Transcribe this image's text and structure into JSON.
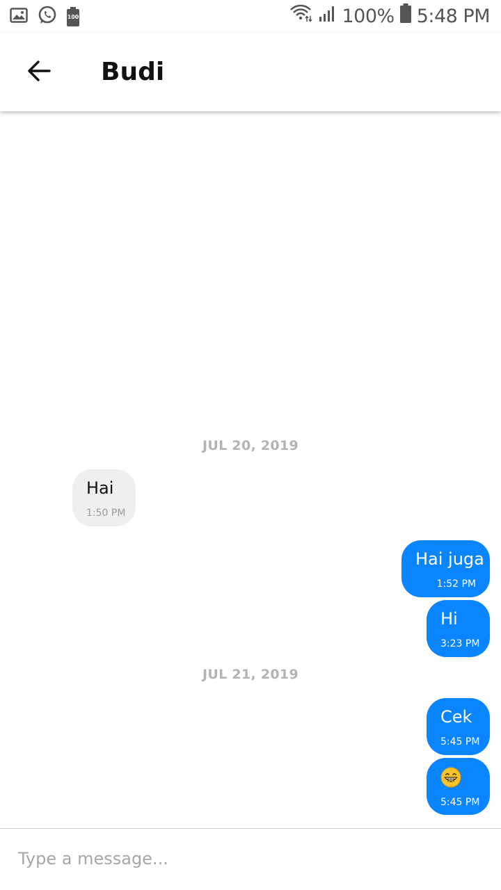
{
  "status_bar": {
    "left_icons": [
      "gallery-icon",
      "whatsapp-icon",
      "battery-saver-icon"
    ],
    "battery_saver_label": "100",
    "battery_percent": "100%",
    "time": "5:48 PM",
    "right_icons": [
      "wifi-icon",
      "signal-icon",
      "battery-icon"
    ]
  },
  "header": {
    "back_icon": "arrow-left-icon",
    "title": "Budi"
  },
  "conversation": {
    "groups": [
      {
        "date": "JUL 20, 2019",
        "messages": [
          {
            "direction": "in",
            "text": "Hai",
            "time": "1:50 PM"
          },
          {
            "direction": "out",
            "text": "Hai juga",
            "time": "1:52 PM"
          },
          {
            "direction": "out",
            "text": "Hi",
            "time": "3:23 PM"
          }
        ]
      },
      {
        "date": "JUL 21, 2019",
        "messages": [
          {
            "direction": "out",
            "text": "Cek",
            "time": "5:45 PM"
          },
          {
            "direction": "out",
            "emoji": "grinning-face-icon",
            "time": "5:45 PM"
          }
        ]
      }
    ]
  },
  "composer": {
    "placeholder": "Type a message..."
  },
  "colors": {
    "outgoing_bubble": "#0a84ff",
    "incoming_bubble": "#efefef",
    "date_separator": "#b3b3b3"
  }
}
